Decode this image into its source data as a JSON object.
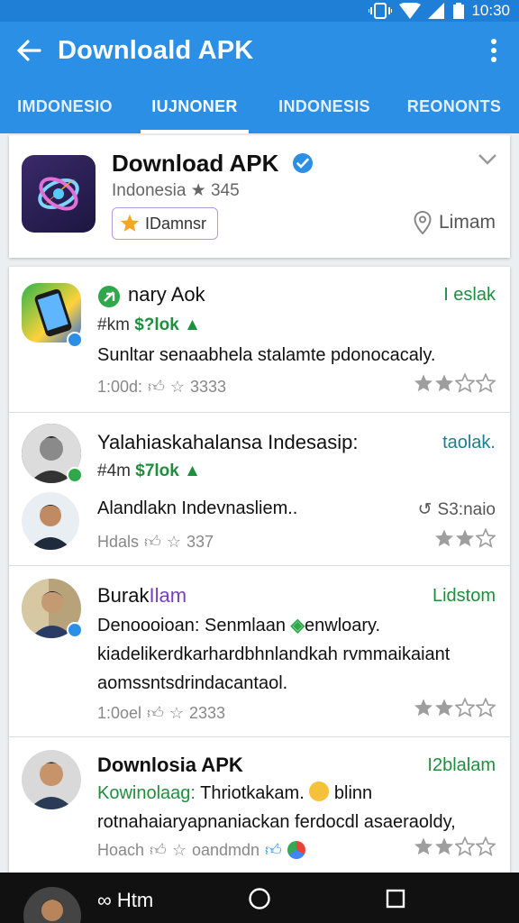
{
  "status_bar": {
    "time": "10:30"
  },
  "app_bar": {
    "title": "Downloald APK"
  },
  "tabs": [
    {
      "label": "IMDONESIO",
      "active": false
    },
    {
      "label": "IUJNONER",
      "active": true
    },
    {
      "label": "INDONESIS",
      "active": false
    },
    {
      "label": "REONONTS",
      "active": false
    }
  ],
  "app_card": {
    "name": "Download APK",
    "meta": "Indonesia ★ 345",
    "badge": "IDamnsr",
    "location": "Limam"
  },
  "items": [
    {
      "title": "nary Aok",
      "tag": "I eslak",
      "price_prefix": "#km",
      "price": "$?lok",
      "desc": [
        "Sunltar senaabhela stalamte pdonocacaly."
      ],
      "stats": "1:00d:",
      "stats_count": "3333",
      "rating": 2
    },
    {
      "title": "Yalahiaskahalansa Indesasip:",
      "tag": "taolak.",
      "price_prefix": "#4m",
      "price": "$7lok",
      "desc": [
        "Alandlakn Indevnasliem.."
      ],
      "side": "S3:naio",
      "stats": "Hdals",
      "stats_count": "337",
      "rating": 2
    },
    {
      "title": "Burak",
      "title_accent": "Ilam",
      "tag": "Lidstom",
      "desc": [
        "Denoooioan: Senmlaan",
        "kiadelikerdkarhardbhnlandkah rvmmaikaiant",
        "aomssntsdrindacantaol."
      ],
      "desc_accent": "enwloary.",
      "stats": "1:0oel",
      "stats_count": "2333",
      "rating": 2
    },
    {
      "title": "Downlosia APK",
      "tag": "I2blalam",
      "desc_green": "Kowinolaag:",
      "desc": [
        "Thriotkakam.",
        "rotnahaiaryapnaniackan ferdocdl asaeraoldy,"
      ],
      "desc_tail": "blinn",
      "stats": "Hoach",
      "stats_count": "oandmdn",
      "rating": 2
    }
  ],
  "nav_bar": {
    "label": "Htm"
  },
  "colors": {
    "primary": "#2b8fe6",
    "status": "#1f7fd6",
    "green": "#1e8f3c",
    "purple": "#7a3fb8"
  }
}
